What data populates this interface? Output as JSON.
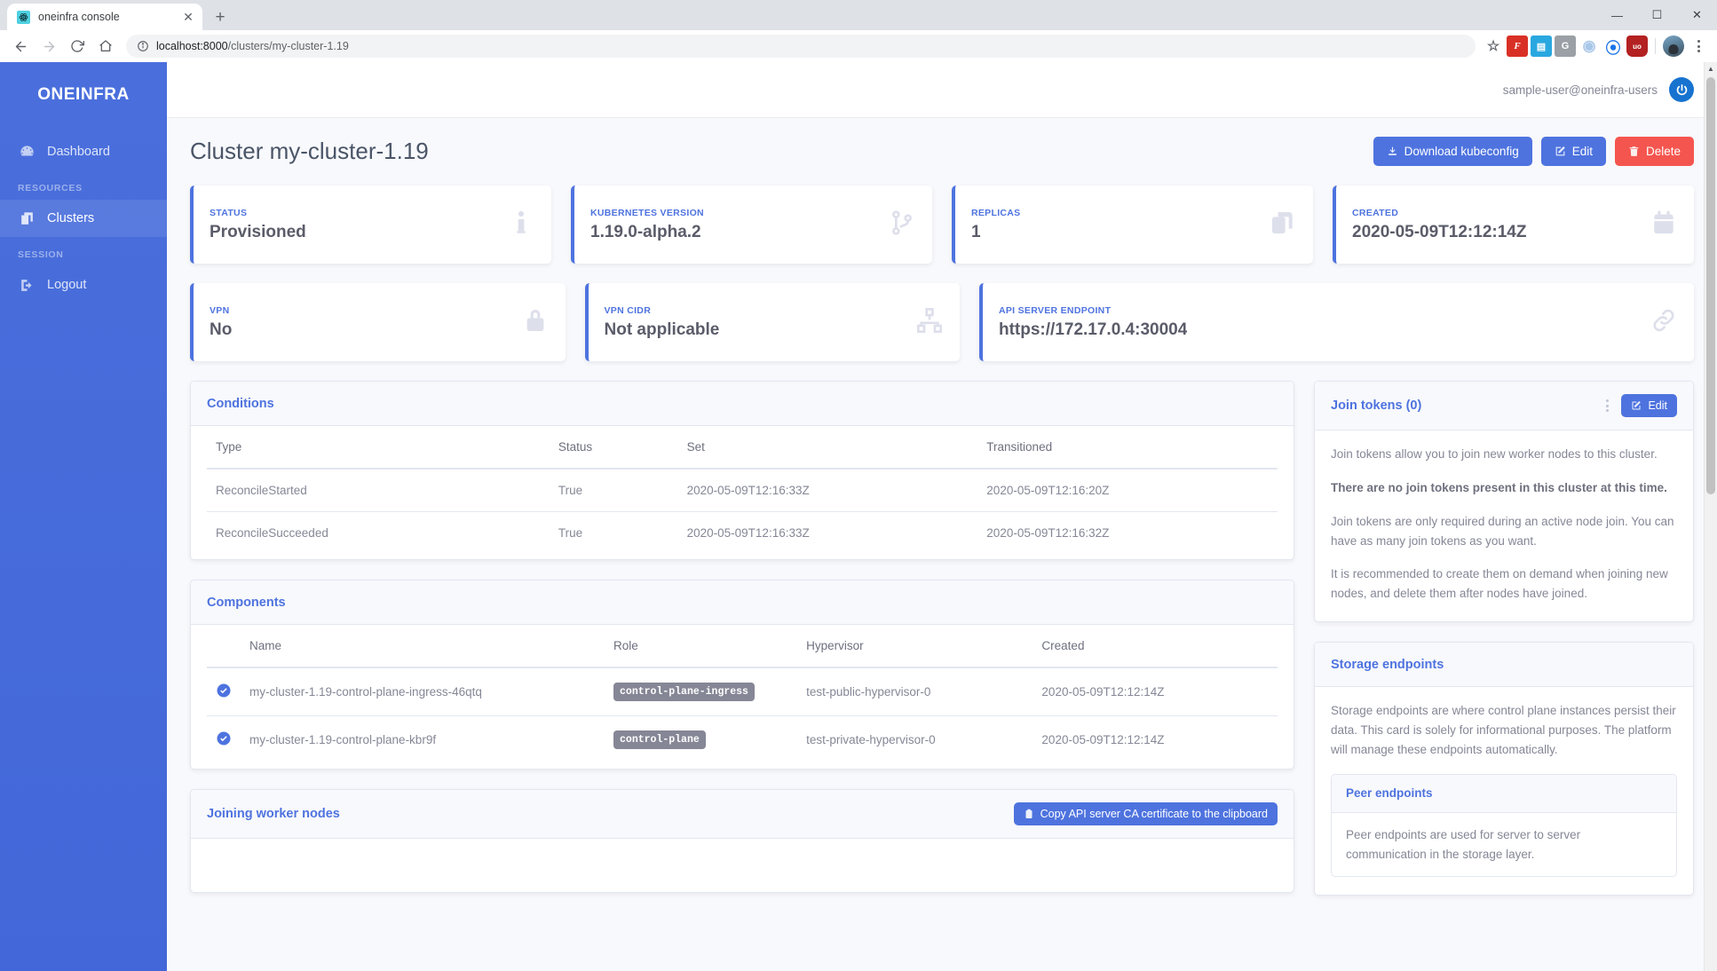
{
  "browser": {
    "tab": {
      "title": "oneinfra console",
      "favicon_icon": "react-atom-icon",
      "close_icon": "close-icon"
    },
    "new_tab_icon": "plus-icon",
    "window_controls": {
      "minimize": "—",
      "maximize": "☐",
      "close": "✕"
    },
    "nav": {
      "back_icon": "arrow-left-icon",
      "forward_icon": "arrow-right-icon",
      "reload_icon": "reload-icon",
      "home_icon": "home-icon"
    },
    "omnibox": {
      "info_icon": "info-circle-icon",
      "url_host": "localhost:8000",
      "url_path": "/clusters/my-cluster-1.19"
    },
    "toolbar_icons": [
      {
        "name": "bookmark-star-icon",
        "glyph": "☆",
        "color": "#5f6368",
        "bg": "transparent"
      },
      {
        "name": "extension-f-icon",
        "glyph": "F",
        "color": "#ffffff",
        "bg": "#d93025"
      },
      {
        "name": "extension-screenshot-icon",
        "glyph": "▤",
        "color": "#ffffff",
        "bg": "#29a8e0"
      },
      {
        "name": "extension-g-icon",
        "glyph": "G",
        "color": "#ffffff",
        "bg": "#9aa0a6"
      },
      {
        "name": "extension-ring-icon",
        "glyph": "◉",
        "color": "#ffffff",
        "bg": "#a9c7e8"
      },
      {
        "name": "extension-plus-circle-icon",
        "glyph": "✥",
        "color": "#ffffff",
        "bg": "#1a73e8"
      },
      {
        "name": "extension-ublock-icon",
        "glyph": "uo",
        "color": "#ffffff",
        "bg": "#b32121"
      }
    ],
    "avatar_name": "profile-avatar",
    "menu_icon": "three-dots-menu-icon"
  },
  "sidebar": {
    "brand": "ONEINFRA",
    "items": [
      {
        "label": "Dashboard",
        "icon": "speedometer-icon",
        "active": false
      },
      {
        "label": "Clusters",
        "icon": "copies-icon",
        "active": true
      },
      {
        "label": "Logout",
        "icon": "sign-out-icon",
        "active": false
      }
    ],
    "headings": {
      "resources": "RESOURCES",
      "session": "SESSION"
    }
  },
  "topbar": {
    "user_email": "sample-user@oneinfra-users",
    "power_icon": "power-logout-icon"
  },
  "page": {
    "title": "Cluster my-cluster-1.19",
    "actions": [
      {
        "label": "Download kubeconfig",
        "icon": "download-icon",
        "style": "primary"
      },
      {
        "label": "Edit",
        "icon": "edit-pencil-icon",
        "style": "primary"
      },
      {
        "label": "Delete",
        "icon": "trash-icon",
        "style": "danger"
      }
    ]
  },
  "stats_row1": [
    {
      "label": "STATUS",
      "value": "Provisioned",
      "icon": "info-icon"
    },
    {
      "label": "KUBERNETES VERSION",
      "value": "1.19.0-alpha.2",
      "icon": "code-branch-icon"
    },
    {
      "label": "REPLICAS",
      "value": "1",
      "icon": "copies-icon"
    },
    {
      "label": "CREATED",
      "value": "2020-05-09T12:12:14Z",
      "icon": "calendar-icon"
    }
  ],
  "stats_row2": [
    {
      "label": "VPN",
      "value": "No",
      "icon": "lock-icon"
    },
    {
      "label": "VPN CIDR",
      "value": "Not applicable",
      "icon": "sitemap-icon"
    },
    {
      "label": "API SERVER ENDPOINT",
      "value": "https://172.17.0.4:30004",
      "icon": "link-icon"
    }
  ],
  "conditions": {
    "title": "Conditions",
    "columns": [
      "Type",
      "Status",
      "Set",
      "Transitioned"
    ],
    "rows": [
      [
        "ReconcileStarted",
        "True",
        "2020-05-09T12:16:33Z",
        "2020-05-09T12:16:20Z"
      ],
      [
        "ReconcileSucceeded",
        "True",
        "2020-05-09T12:16:33Z",
        "2020-05-09T12:16:32Z"
      ]
    ]
  },
  "components": {
    "title": "Components",
    "columns": [
      "",
      "Name",
      "Role",
      "Hypervisor",
      "Created"
    ],
    "rows": [
      {
        "status_icon": "check-circle-icon",
        "name": "my-cluster-1.19-control-plane-ingress-46qtq",
        "role": "control-plane-ingress",
        "hypervisor": "test-public-hypervisor-0",
        "created": "2020-05-09T12:12:14Z"
      },
      {
        "status_icon": "check-circle-icon",
        "name": "my-cluster-1.19-control-plane-kbr9f",
        "role": "control-plane",
        "hypervisor": "test-private-hypervisor-0",
        "created": "2020-05-09T12:12:14Z"
      }
    ]
  },
  "joining_worker_nodes": {
    "title": "Joining worker nodes",
    "copy_button": {
      "label": "Copy API server CA certificate to the clipboard",
      "icon": "clipboard-icon"
    }
  },
  "join_tokens": {
    "title": "Join tokens (0)",
    "menu_icon": "vertical-dots-icon",
    "edit_button": {
      "label": "Edit",
      "icon": "edit-pencil-icon"
    },
    "p1": "Join tokens allow you to join new worker nodes to this cluster.",
    "p2": "There are no join tokens present in this cluster at this time.",
    "p3": "Join tokens are only required during an active node join. You can have as many join tokens as you want.",
    "p4": "It is recommended to create them on demand when joining new nodes, and delete them after nodes have joined."
  },
  "storage_endpoints": {
    "title": "Storage endpoints",
    "p1": "Storage endpoints are where control plane instances persist their data. This card is solely for informational purposes. The platform will manage these endpoints automatically.",
    "peer": {
      "title": "Peer endpoints",
      "p1": "Peer endpoints are used for server to server communication in the storage layer."
    }
  },
  "colors": {
    "brand_blue": "#4e73df",
    "sidebar_blue": "#4367d8",
    "danger_red": "#f4564f",
    "muted_text": "#858796",
    "bg": "#f8f9fc",
    "border": "#e3e6f0"
  }
}
